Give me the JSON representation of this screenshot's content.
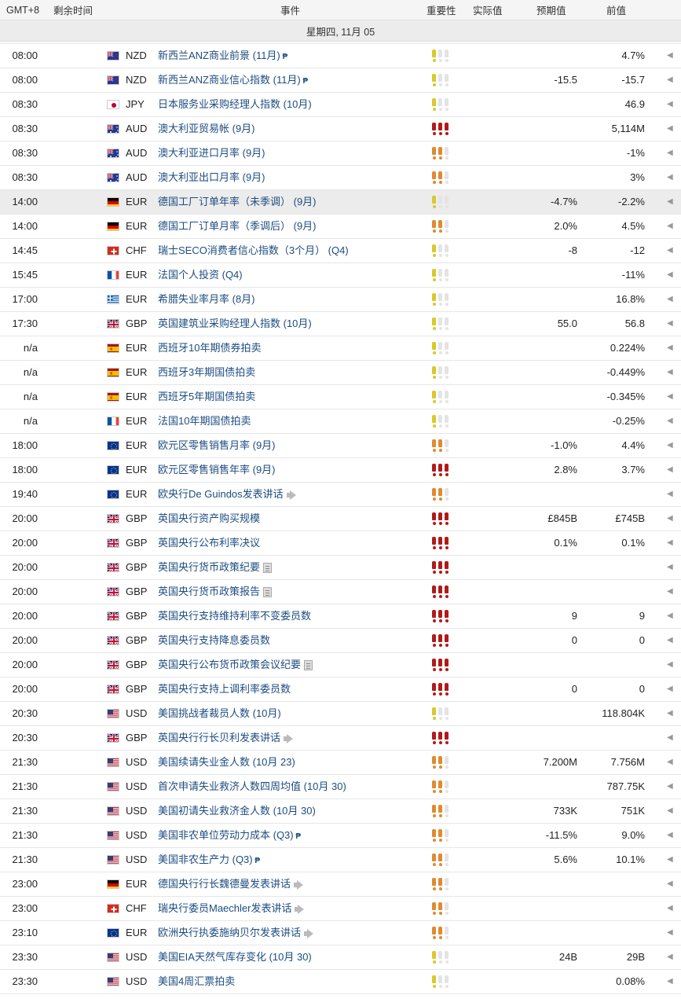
{
  "header": {
    "timezone": "GMT+8",
    "remaining": "剩余时间",
    "event": "事件",
    "importance": "重要性",
    "actual": "实际值",
    "forecast": "预期值",
    "previous": "前值"
  },
  "day_label": "星期四, 11月 05",
  "colors": {
    "low": "#d9c92a",
    "medium": "#e08a2e",
    "high": "#b11a1a",
    "empty": "#e4e4e4",
    "link": "#1d4c80"
  },
  "rows": [
    {
      "time": "08:00",
      "flag": "nz",
      "currency": "NZD",
      "event": "新西兰ANZ商业前景 (11月)",
      "icon": "p-icon",
      "importance": 1,
      "imp_color": "low",
      "actual": "",
      "forecast": "",
      "previous": "4.7%"
    },
    {
      "time": "08:00",
      "flag": "nz",
      "currency": "NZD",
      "event": "新西兰ANZ商业信心指数 (11月)",
      "icon": "p-icon",
      "importance": 1,
      "imp_color": "low",
      "actual": "",
      "forecast": "-15.5",
      "previous": "-15.7"
    },
    {
      "time": "08:30",
      "flag": "jp",
      "currency": "JPY",
      "event": "日本服务业采购经理人指数 (10月)",
      "icon": "",
      "importance": 1,
      "imp_color": "low",
      "actual": "",
      "forecast": "",
      "previous": "46.9"
    },
    {
      "time": "08:30",
      "flag": "au",
      "currency": "AUD",
      "event": "澳大利亚贸易帐 (9月)",
      "icon": "",
      "importance": 3,
      "imp_color": "high",
      "actual": "",
      "forecast": "",
      "previous": "5,114M"
    },
    {
      "time": "08:30",
      "flag": "au",
      "currency": "AUD",
      "event": "澳大利亚进口月率 (9月)",
      "icon": "",
      "importance": 2,
      "imp_color": "medium",
      "actual": "",
      "forecast": "",
      "previous": "-1%"
    },
    {
      "time": "08:30",
      "flag": "au",
      "currency": "AUD",
      "event": "澳大利亚出口月率 (9月)",
      "icon": "",
      "importance": 2,
      "imp_color": "medium",
      "actual": "",
      "forecast": "",
      "previous": "3%"
    },
    {
      "time": "14:00",
      "flag": "de",
      "currency": "EUR",
      "event": "德国工厂订单年率（未季调） (9月)",
      "icon": "",
      "importance": 1,
      "imp_color": "low",
      "actual": "",
      "forecast": "-4.7%",
      "previous": "-2.2%",
      "highlight": true
    },
    {
      "time": "14:00",
      "flag": "de",
      "currency": "EUR",
      "event": "德国工厂订单月率（季调后） (9月)",
      "icon": "",
      "importance": 2,
      "imp_color": "medium",
      "actual": "",
      "forecast": "2.0%",
      "previous": "4.5%"
    },
    {
      "time": "14:45",
      "flag": "ch",
      "currency": "CHF",
      "event": "瑞士SECO消费者信心指数（3个月） (Q4)",
      "icon": "",
      "importance": 1,
      "imp_color": "low",
      "actual": "",
      "forecast": "-8",
      "previous": "-12"
    },
    {
      "time": "15:45",
      "flag": "fr",
      "currency": "EUR",
      "event": "法国个人投资 (Q4)",
      "icon": "",
      "importance": 1,
      "imp_color": "low",
      "actual": "",
      "forecast": "",
      "previous": "-11%"
    },
    {
      "time": "17:00",
      "flag": "gr",
      "currency": "EUR",
      "event": "希腊失业率月率 (8月)",
      "icon": "",
      "importance": 1,
      "imp_color": "low",
      "actual": "",
      "forecast": "",
      "previous": "16.8%"
    },
    {
      "time": "17:30",
      "flag": "gb",
      "currency": "GBP",
      "event": "英国建筑业采购经理人指数 (10月)",
      "icon": "",
      "importance": 1,
      "imp_color": "low",
      "actual": "",
      "forecast": "55.0",
      "previous": "56.8"
    },
    {
      "time": "n/a",
      "flag": "es",
      "currency": "EUR",
      "event": "西班牙10年期债券拍卖",
      "icon": "",
      "importance": 1,
      "imp_color": "low",
      "actual": "",
      "forecast": "",
      "previous": "0.224%"
    },
    {
      "time": "n/a",
      "flag": "es",
      "currency": "EUR",
      "event": "西班牙3年期国债拍卖",
      "icon": "",
      "importance": 1,
      "imp_color": "low",
      "actual": "",
      "forecast": "",
      "previous": "-0.449%"
    },
    {
      "time": "n/a",
      "flag": "es",
      "currency": "EUR",
      "event": "西班牙5年期国债拍卖",
      "icon": "",
      "importance": 1,
      "imp_color": "low",
      "actual": "",
      "forecast": "",
      "previous": "-0.345%"
    },
    {
      "time": "n/a",
      "flag": "fr",
      "currency": "EUR",
      "event": "法国10年期国债拍卖",
      "icon": "",
      "importance": 1,
      "imp_color": "low",
      "actual": "",
      "forecast": "",
      "previous": "-0.25%"
    },
    {
      "time": "18:00",
      "flag": "eu",
      "currency": "EUR",
      "event": "欧元区零售销售月率 (9月)",
      "icon": "",
      "importance": 2,
      "imp_color": "medium",
      "actual": "",
      "forecast": "-1.0%",
      "previous": "4.4%"
    },
    {
      "time": "18:00",
      "flag": "eu",
      "currency": "EUR",
      "event": "欧元区零售销售年率 (9月)",
      "icon": "",
      "importance": 3,
      "imp_color": "high",
      "actual": "",
      "forecast": "2.8%",
      "previous": "3.7%"
    },
    {
      "time": "19:40",
      "flag": "eu",
      "currency": "EUR",
      "event": "欧央行De Guindos发表讲话",
      "icon": "mega-icon",
      "importance": 2,
      "imp_color": "medium",
      "actual": "",
      "forecast": "",
      "previous": ""
    },
    {
      "time": "20:00",
      "flag": "gb",
      "currency": "GBP",
      "event": "英国央行资产购买规模",
      "icon": "",
      "importance": 3,
      "imp_color": "high",
      "actual": "",
      "forecast": "£845B",
      "previous": "£745B"
    },
    {
      "time": "20:00",
      "flag": "gb",
      "currency": "GBP",
      "event": "英国央行公布利率决议",
      "icon": "",
      "importance": 3,
      "imp_color": "high",
      "actual": "",
      "forecast": "0.1%",
      "previous": "0.1%"
    },
    {
      "time": "20:00",
      "flag": "gb",
      "currency": "GBP",
      "event": "英国央行货币政策纪要",
      "icon": "doc-icon",
      "importance": 3,
      "imp_color": "high",
      "actual": "",
      "forecast": "",
      "previous": ""
    },
    {
      "time": "20:00",
      "flag": "gb",
      "currency": "GBP",
      "event": "英国央行货币政策报告",
      "icon": "doc-icon",
      "importance": 3,
      "imp_color": "high",
      "actual": "",
      "forecast": "",
      "previous": ""
    },
    {
      "time": "20:00",
      "flag": "gb",
      "currency": "GBP",
      "event": "英国央行支持维持利率不变委员数",
      "icon": "",
      "importance": 3,
      "imp_color": "high",
      "actual": "",
      "forecast": "9",
      "previous": "9"
    },
    {
      "time": "20:00",
      "flag": "gb",
      "currency": "GBP",
      "event": "英国央行支持降息委员数",
      "icon": "",
      "importance": 3,
      "imp_color": "high",
      "actual": "",
      "forecast": "0",
      "previous": "0"
    },
    {
      "time": "20:00",
      "flag": "gb",
      "currency": "GBP",
      "event": "英国央行公布货币政策会议纪要",
      "icon": "doc-icon",
      "importance": 3,
      "imp_color": "high",
      "actual": "",
      "forecast": "",
      "previous": ""
    },
    {
      "time": "20:00",
      "flag": "gb",
      "currency": "GBP",
      "event": "英国央行支持上调利率委员数",
      "icon": "",
      "importance": 3,
      "imp_color": "high",
      "actual": "",
      "forecast": "0",
      "previous": "0"
    },
    {
      "time": "20:30",
      "flag": "us",
      "currency": "USD",
      "event": "美国挑战者裁员人数 (10月)",
      "icon": "",
      "importance": 1,
      "imp_color": "low",
      "actual": "",
      "forecast": "",
      "previous": "118.804K"
    },
    {
      "time": "20:30",
      "flag": "gb",
      "currency": "GBP",
      "event": "英国央行行长贝利发表讲话",
      "icon": "mega-icon",
      "importance": 3,
      "imp_color": "high",
      "actual": "",
      "forecast": "",
      "previous": ""
    },
    {
      "time": "21:30",
      "flag": "us",
      "currency": "USD",
      "event": "美国续请失业金人数 (10月 23)",
      "icon": "",
      "importance": 2,
      "imp_color": "medium",
      "actual": "",
      "forecast": "7.200M",
      "previous": "7.756M"
    },
    {
      "time": "21:30",
      "flag": "us",
      "currency": "USD",
      "event": "首次申请失业救济人数四周均值 (10月 30)",
      "icon": "",
      "importance": 2,
      "imp_color": "medium",
      "actual": "",
      "forecast": "",
      "previous": "787.75K"
    },
    {
      "time": "21:30",
      "flag": "us",
      "currency": "USD",
      "event": "美国初请失业救济金人数 (10月 30)",
      "icon": "",
      "importance": 2,
      "imp_color": "medium",
      "actual": "",
      "forecast": "733K",
      "previous": "751K"
    },
    {
      "time": "21:30",
      "flag": "us",
      "currency": "USD",
      "event": "美国非农单位劳动力成本 (Q3)",
      "icon": "p-icon",
      "importance": 2,
      "imp_color": "medium",
      "actual": "",
      "forecast": "-11.5%",
      "previous": "9.0%"
    },
    {
      "time": "21:30",
      "flag": "us",
      "currency": "USD",
      "event": "美国非农生产力 (Q3)",
      "icon": "p-icon",
      "importance": 2,
      "imp_color": "medium",
      "actual": "",
      "forecast": "5.6%",
      "previous": "10.1%"
    },
    {
      "time": "23:00",
      "flag": "de",
      "currency": "EUR",
      "event": "德国央行行长魏德曼发表讲话",
      "icon": "mega-icon",
      "importance": 2,
      "imp_color": "medium",
      "actual": "",
      "forecast": "",
      "previous": ""
    },
    {
      "time": "23:00",
      "flag": "ch",
      "currency": "CHF",
      "event": "瑞央行委员Maechler发表讲话",
      "icon": "mega-icon",
      "importance": 2,
      "imp_color": "medium",
      "actual": "",
      "forecast": "",
      "previous": ""
    },
    {
      "time": "23:10",
      "flag": "eu",
      "currency": "EUR",
      "event": "欧洲央行执委施纳贝尔发表讲话",
      "icon": "mega-icon",
      "importance": 2,
      "imp_color": "medium",
      "actual": "",
      "forecast": "",
      "previous": ""
    },
    {
      "time": "23:30",
      "flag": "us",
      "currency": "USD",
      "event": "美国EIA天然气库存变化 (10月 30)",
      "icon": "",
      "importance": 1,
      "imp_color": "low",
      "actual": "",
      "forecast": "24B",
      "previous": "29B"
    },
    {
      "time": "23:30",
      "flag": "us",
      "currency": "USD",
      "event": "美国4周汇票拍卖",
      "icon": "",
      "importance": 1,
      "imp_color": "low",
      "actual": "",
      "forecast": "",
      "previous": "0.08%"
    }
  ]
}
